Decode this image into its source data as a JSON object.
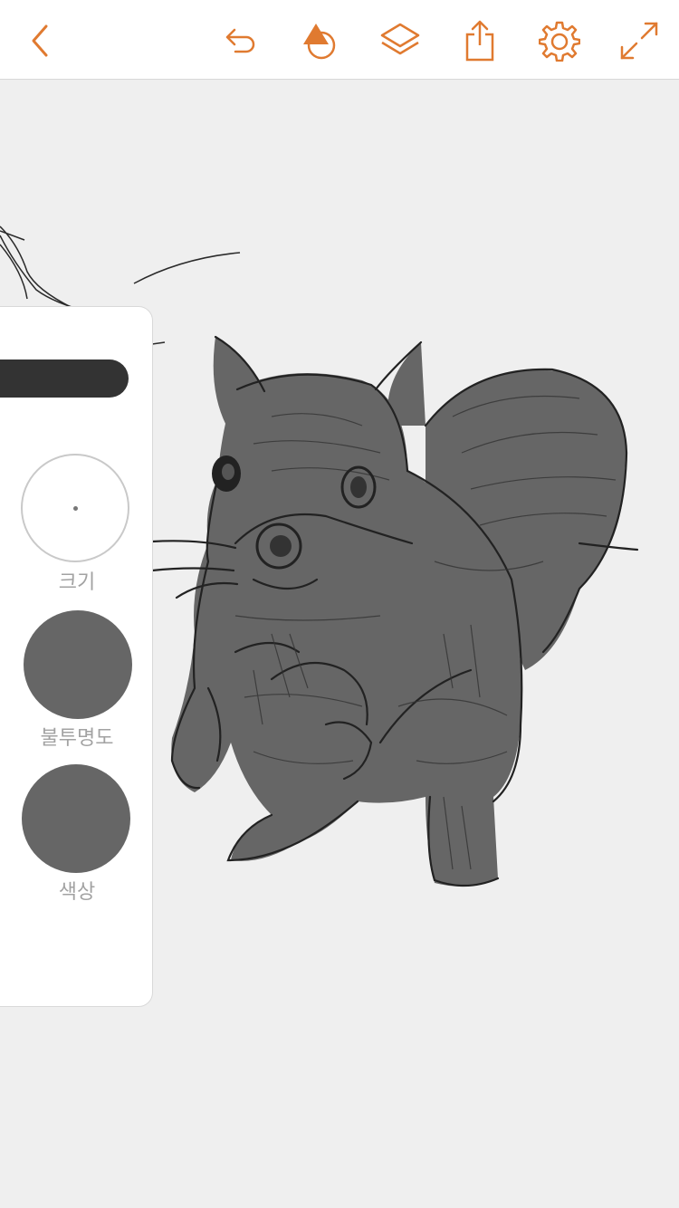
{
  "toolbar": {
    "accent_color": "#e07a30",
    "icons": [
      "back-chevron-icon",
      "undo-icon",
      "shape-brush-icon",
      "layers-icon",
      "share-icon",
      "gear-icon",
      "fullscreen-icon"
    ]
  },
  "brush_panel": {
    "size_label": "크기",
    "opacity_label": "불투명도",
    "color_label": "색상",
    "current_color": "#666666"
  }
}
